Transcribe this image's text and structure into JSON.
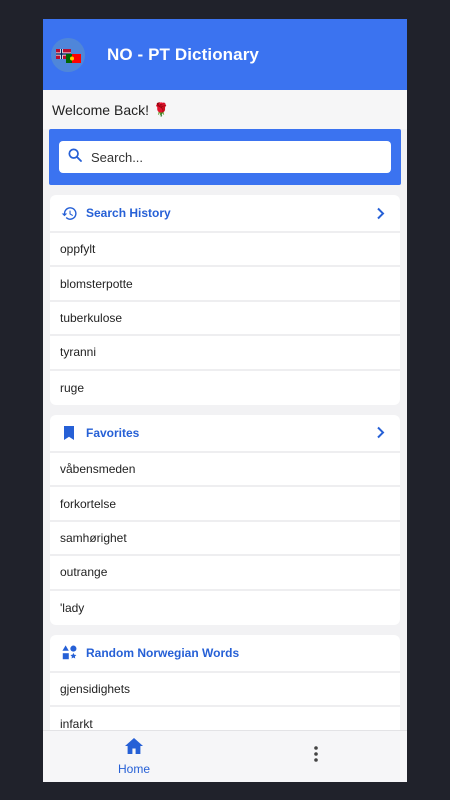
{
  "appbar": {
    "title": "NO - PT Dictionary",
    "avatar_icon": "norway-portugal-flag-icon"
  },
  "welcome": {
    "text": "Welcome Back!",
    "emoji": "🌹"
  },
  "search": {
    "placeholder": "Search..."
  },
  "sections": {
    "history": {
      "title": "Search History",
      "icon": "history-icon",
      "items": [
        "oppfylt",
        "blomsterpotte",
        "tuberkulose",
        "tyranni",
        "ruge"
      ]
    },
    "favorites": {
      "title": "Favorites",
      "icon": "bookmark-icon",
      "items": [
        "våbensmeden",
        "forkortelse",
        "samhørighet",
        "outrange",
        "'lady"
      ]
    },
    "random": {
      "title": "Random Norwegian Words",
      "icon": "shapes-icon",
      "items": [
        "gjensidighets",
        "infarkt"
      ]
    }
  },
  "bottom_nav": {
    "home_label": "Home",
    "more_icon": "more-vertical-icon"
  },
  "colors": {
    "primary": "#3b73f0",
    "accent_text": "#2660d6",
    "background": "#f2f2f4",
    "outer": "#20222b"
  }
}
